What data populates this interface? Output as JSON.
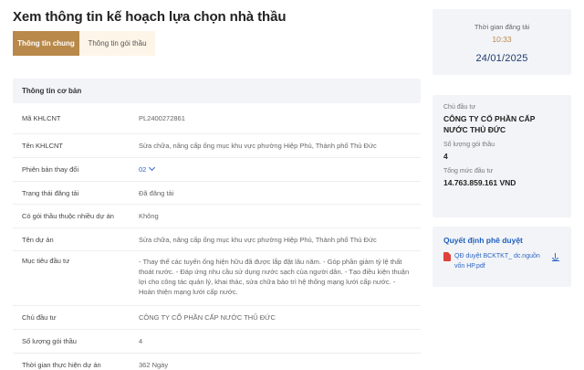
{
  "page": {
    "title": "Xem thông tin kế hoạch lựa chọn nhà thầu"
  },
  "tabs": [
    {
      "label": "Thông tin chung"
    },
    {
      "label": "Thông tin gói thầu"
    }
  ],
  "section": {
    "header": "Thông tin cơ bản"
  },
  "rows": [
    {
      "label": "Mã KHLCNT",
      "value": "PL2400272861"
    },
    {
      "label": "Tên KHLCNT",
      "value": "Sửa chữa, nâng cấp ống mục khu vực phường Hiệp Phú, Thành phố Thủ Đức"
    },
    {
      "label": "Phiên bản thay đổi",
      "value": "02"
    },
    {
      "label": "Trạng thái đăng tải",
      "value": "Đã đăng tải"
    },
    {
      "label": "Có gói thầu thuộc nhiều dự án",
      "value": "Không"
    },
    {
      "label": "Tên dự án",
      "value": "Sửa chữa, nâng cấp ống mục khu vực phường Hiệp Phú, Thành phố Thủ Đức"
    },
    {
      "label": "Mục tiêu đầu tư",
      "value": "- Thay thế các tuyến ống hiện hữu đã được lắp đặt lâu năm. - Góp phần giảm tỷ lệ thất thoát nước. - Đáp ứng nhu cầu sử dụng nước sạch của người dân. - Tạo điều kiện thuận lợi cho công tác quản lý, khai thác, sửa chữa bảo trì hệ thống mạng lưới cấp nước. - Hoàn thiện mạng lưới cấp nước."
    },
    {
      "label": "Chủ đầu tư",
      "value": "CÔNG TY CỔ PHẦN CẤP NƯỚC THỦ ĐỨC"
    },
    {
      "label": "Số lượng gói thầu",
      "value": "4"
    },
    {
      "label": "Thời gian thực hiện dự án",
      "value": "362 Ngày"
    }
  ],
  "post_date": {
    "label": "Thời gian đăng tải",
    "time": "10:33",
    "date": "24/01/2025"
  },
  "investor_card": {
    "investor_label": "Chủ đầu tư",
    "investor_value": "CÔNG TY CỔ PHẦN CẤP NƯỚC THỦ ĐỨC",
    "packages_label": "Số lượng gói thầu",
    "packages_value": "4",
    "total_label": "Tổng mức đầu tư",
    "total_value": "14.763.859.161 VND"
  },
  "decision_card": {
    "title": "Quyết định phê duyệt",
    "file_name": "QĐ duyệt BCKTKT_ dc.nguồn vốn HP.pdf"
  },
  "colors": {
    "accent": "#b8894a",
    "link": "#2f66c5",
    "panel": "#f2f4f7",
    "date": "#1f3a6e"
  }
}
